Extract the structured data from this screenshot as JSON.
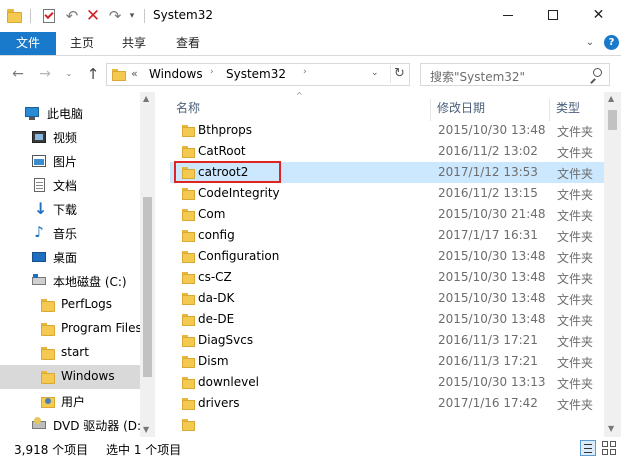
{
  "window": {
    "title": "System32",
    "minimize_glyph": "",
    "close_glyph": "✕"
  },
  "quick_access": {
    "undo_glyph": "↶",
    "delete_glyph": "✕",
    "redo_glyph": "↷",
    "dropdown_glyph": "▾"
  },
  "ribbon": {
    "tabs": [
      "文件",
      "主页",
      "共享",
      "查看"
    ],
    "expand_glyph": "⌄",
    "help_glyph": "?"
  },
  "nav": {
    "back_glyph": "←",
    "forward_glyph": "→",
    "recent_glyph": "⌄",
    "up_glyph": "↑"
  },
  "address": {
    "overflow": "«",
    "crumbs": [
      "Windows",
      "System32"
    ],
    "separator": "›",
    "dropdown_glyph": "⌄",
    "refresh_glyph": "↻"
  },
  "search": {
    "placeholder": "搜索\"System32\""
  },
  "sidebar": {
    "items": [
      {
        "label": "此电脑",
        "icon": "computer-icon"
      },
      {
        "label": "视频",
        "icon": "video-icon"
      },
      {
        "label": "图片",
        "icon": "pictures-icon"
      },
      {
        "label": "文档",
        "icon": "documents-icon"
      },
      {
        "label": "下载",
        "icon": "download-icon"
      },
      {
        "label": "音乐",
        "icon": "music-icon"
      },
      {
        "label": "桌面",
        "icon": "desktop-icon"
      },
      {
        "label": "本地磁盘 (C:)",
        "icon": "drive-icon"
      },
      {
        "label": "PerfLogs",
        "icon": "folder-icon"
      },
      {
        "label": "Program Files",
        "icon": "folder-icon"
      },
      {
        "label": "start",
        "icon": "folder-icon"
      },
      {
        "label": "Windows",
        "icon": "folder-icon",
        "selected": true
      },
      {
        "label": "用户",
        "icon": "user-folder-icon"
      },
      {
        "label": "DVD 驱动器 (D:",
        "icon": "dvd-drive-icon"
      }
    ]
  },
  "columns": {
    "name": "名称",
    "date": "修改日期",
    "type": "类型",
    "sort_glyph": "^"
  },
  "files": [
    {
      "name": "Bthprops",
      "date": "2015/10/30 13:48",
      "type": "文件夹"
    },
    {
      "name": "CatRoot",
      "date": "2016/11/2 13:02",
      "type": "文件夹"
    },
    {
      "name": "catroot2",
      "date": "2017/1/12 13:53",
      "type": "文件夹",
      "selected": true
    },
    {
      "name": "CodeIntegrity",
      "date": "2016/11/2 13:15",
      "type": "文件夹"
    },
    {
      "name": "Com",
      "date": "2015/10/30 21:48",
      "type": "文件夹"
    },
    {
      "name": "config",
      "date": "2017/1/17 16:31",
      "type": "文件夹"
    },
    {
      "name": "Configuration",
      "date": "2015/10/30 13:48",
      "type": "文件夹"
    },
    {
      "name": "cs-CZ",
      "date": "2015/10/30 13:48",
      "type": "文件夹"
    },
    {
      "name": "da-DK",
      "date": "2015/10/30 13:48",
      "type": "文件夹"
    },
    {
      "name": "de-DE",
      "date": "2015/10/30 13:48",
      "type": "文件夹"
    },
    {
      "name": "DiagSvcs",
      "date": "2016/11/3 17:21",
      "type": "文件夹"
    },
    {
      "name": "Dism",
      "date": "2016/11/3 17:21",
      "type": "文件夹"
    },
    {
      "name": "downlevel",
      "date": "2015/10/30 13:13",
      "type": "文件夹"
    },
    {
      "name": "drivers",
      "date": "2017/1/16 17:42",
      "type": "文件夹"
    }
  ],
  "scroll_glyphs": {
    "up": "▲",
    "down": "▼"
  },
  "status": {
    "count": "3,918 个项目",
    "selected": "选中 1 个项目"
  },
  "colors": {
    "accent": "#1979ca",
    "selection": "#cce8ff",
    "highlight_box": "#e02323",
    "folder": "#f3c94f"
  }
}
